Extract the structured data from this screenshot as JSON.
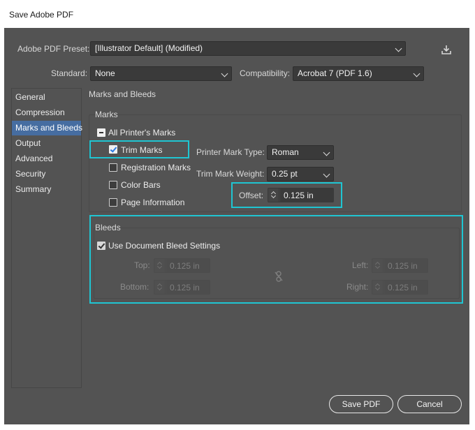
{
  "window": {
    "title": "Save Adobe PDF"
  },
  "preset": {
    "label": "Adobe PDF Preset:",
    "value": "[Illustrator Default] (Modified)"
  },
  "standard": {
    "label": "Standard:",
    "value": "None"
  },
  "compatibility": {
    "label": "Compatibility:",
    "value": "Acrobat 7 (PDF 1.6)"
  },
  "sidebar": {
    "items": [
      {
        "label": "General"
      },
      {
        "label": "Compression"
      },
      {
        "label": "Marks and Bleeds"
      },
      {
        "label": "Output"
      },
      {
        "label": "Advanced"
      },
      {
        "label": "Security"
      },
      {
        "label": "Summary"
      }
    ],
    "active": "Marks and Bleeds"
  },
  "section_title": "Marks and Bleeds",
  "marks": {
    "title": "Marks",
    "all_printers_marks": "All Printer's Marks",
    "trim_marks": "Trim Marks",
    "registration_marks": "Registration Marks",
    "color_bars": "Color Bars",
    "page_information": "Page Information",
    "printer_mark_type": {
      "label": "Printer Mark Type:",
      "value": "Roman"
    },
    "trim_mark_weight": {
      "label": "Trim Mark Weight:",
      "value": "0.25 pt"
    },
    "offset": {
      "label": "Offset:",
      "value": "0.125 in"
    }
  },
  "bleeds": {
    "title": "Bleeds",
    "use_document": "Use Document Bleed Settings",
    "top": {
      "label": "Top:",
      "value": "0.125 in"
    },
    "bottom": {
      "label": "Bottom:",
      "value": "0.125 in"
    },
    "left": {
      "label": "Left:",
      "value": "0.125 in"
    },
    "right": {
      "label": "Right:",
      "value": "0.125 in"
    }
  },
  "buttons": {
    "save": "Save PDF",
    "cancel": "Cancel"
  },
  "colors": {
    "accent_highlight": "#1fc5d2",
    "selection": "#466da1",
    "dialog_bg": "#535353"
  },
  "icons": {
    "download": "download-icon",
    "link": "link-broken-icon",
    "chevron": "chevron-down-icon"
  }
}
